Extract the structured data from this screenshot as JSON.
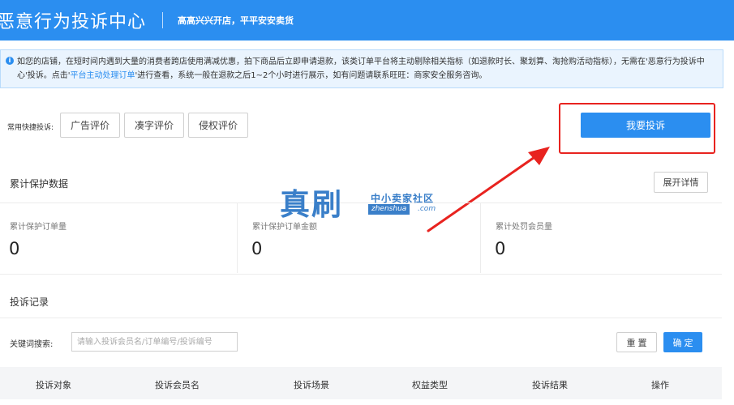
{
  "header": {
    "title": "恶意行为投诉中心",
    "slogan": "高高兴兴开店，平平安安卖货"
  },
  "notice": {
    "icon": "info-icon",
    "text_before": "如您的店铺，在短时间内遇到大量的消费者跨店使用满减优惠，拍下商品后立即申请退款，该类订单平台将主动剔除相关指标（如退款时长、聚划算、淘抢购活动指标），无需在'恶意行为投诉中心'投诉。点击'",
    "link": "平台主动处理订单",
    "text_after": "'进行查看，系统一般在退款之后1~2个小时进行展示，如有问题请联系旺旺：商家安全服务咨询。"
  },
  "shortcuts": {
    "label": "常用快捷投诉:",
    "items": [
      "广告评价",
      "凑字评价",
      "侵权评价"
    ]
  },
  "complain_button": "我要投诉",
  "protection": {
    "title": "累计保护数据",
    "expand_label": "展开详情",
    "stats": [
      {
        "label": "累计保护订单量",
        "value": "0"
      },
      {
        "label": "累计保护订单金额",
        "value": "0"
      },
      {
        "label": "累计处罚会员量",
        "value": "0"
      }
    ]
  },
  "watermark": {
    "main": "真刷",
    "cn": "中小卖家社区",
    "domain": "zhenshua",
    "suffix": ".com"
  },
  "records": {
    "title": "投诉记录",
    "search_label": "关键词搜索:",
    "search_placeholder": "请输入投诉会员名/订单编号/投诉编号",
    "reset_label": "重 置",
    "confirm_label": "确 定",
    "columns": [
      "投诉对象",
      "投诉会员名",
      "投诉场景",
      "权益类型",
      "投诉结果",
      "操作"
    ]
  },
  "colors": {
    "primary": "#2b8ef0",
    "highlight": "#e8231f"
  }
}
